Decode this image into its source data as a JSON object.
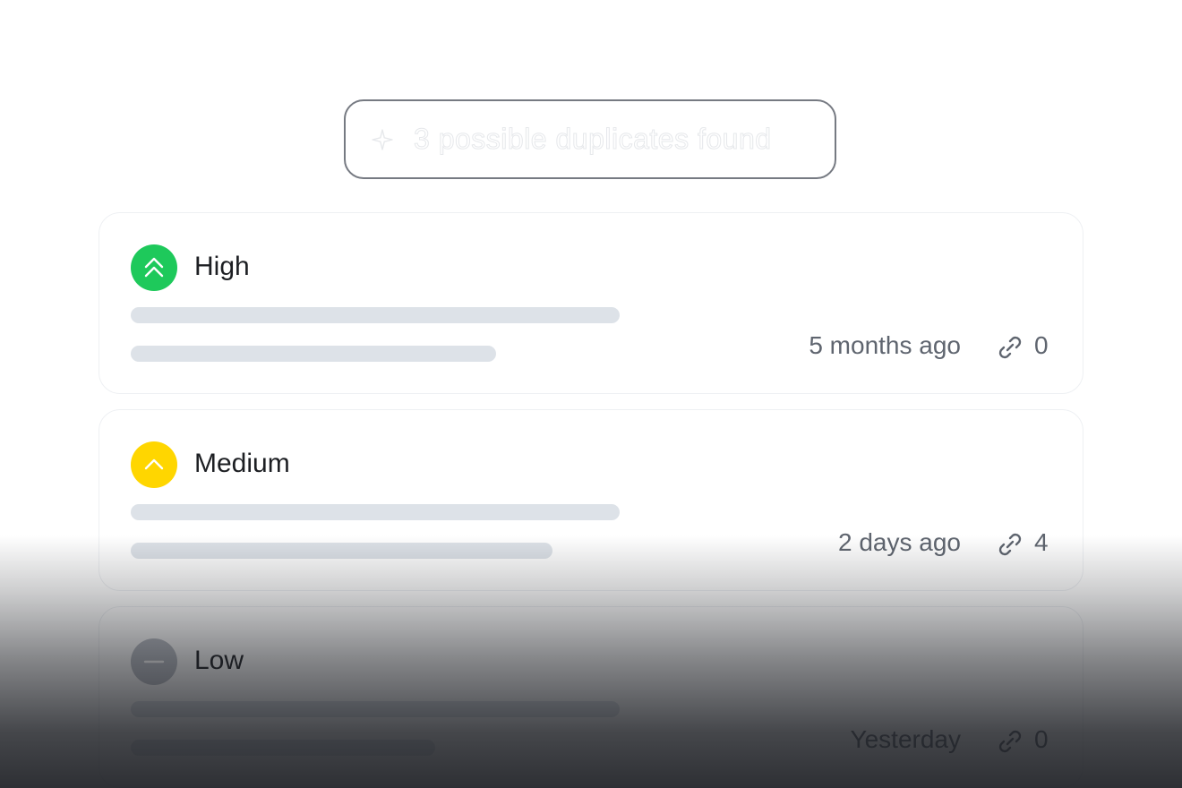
{
  "duplicates": {
    "label": "3 possible duplicates found",
    "icon": "sparkle-icon"
  },
  "issues": [
    {
      "priority": "High",
      "priority_icon": "double-chevron-up-icon",
      "priority_color": "#1ec95b",
      "time": "5 months ago",
      "link_count": "0"
    },
    {
      "priority": "Medium",
      "priority_icon": "chevron-up-icon",
      "priority_color": "#ffd600",
      "time": "2 days ago",
      "link_count": "4"
    },
    {
      "priority": "Low",
      "priority_icon": "minus-icon",
      "priority_color": "#b8bcc4",
      "time": "Yesterday",
      "link_count": "0"
    }
  ]
}
